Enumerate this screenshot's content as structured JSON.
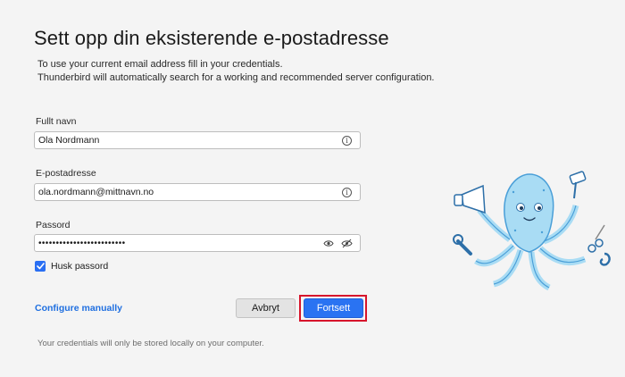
{
  "header": {
    "title": "Sett opp din eksisterende e-postadresse",
    "intro_line1": "To use your current email address fill in your credentials.",
    "intro_line2": "Thunderbird will automatically search for a working and recommended server configuration."
  },
  "form": {
    "fullname": {
      "label": "Fullt navn",
      "value": "Ola Nordmann"
    },
    "email": {
      "label": "E-postadresse",
      "value": "ola.nordmann@mittnavn.no"
    },
    "password": {
      "label": "Passord",
      "value": "•••••••••••••••••••••••••"
    },
    "remember": {
      "label": "Husk passord",
      "checked": true
    }
  },
  "actions": {
    "configure_manually": "Configure manually",
    "cancel": "Avbryt",
    "continue": "Fortsett"
  },
  "footer": {
    "note": "Your credentials will only be stored locally on your computer."
  },
  "icons": {
    "info": "info-icon",
    "show_password": "eye-icon",
    "hide_password": "eye-slash-icon",
    "checkmark": "checkmark-icon",
    "mascot": "octopus-mascot"
  },
  "colors": {
    "accent": "#2a73f2",
    "link": "#1f6fe0",
    "highlight_outline": "#d7142b",
    "mascot_fill": "#a9dcf4"
  }
}
